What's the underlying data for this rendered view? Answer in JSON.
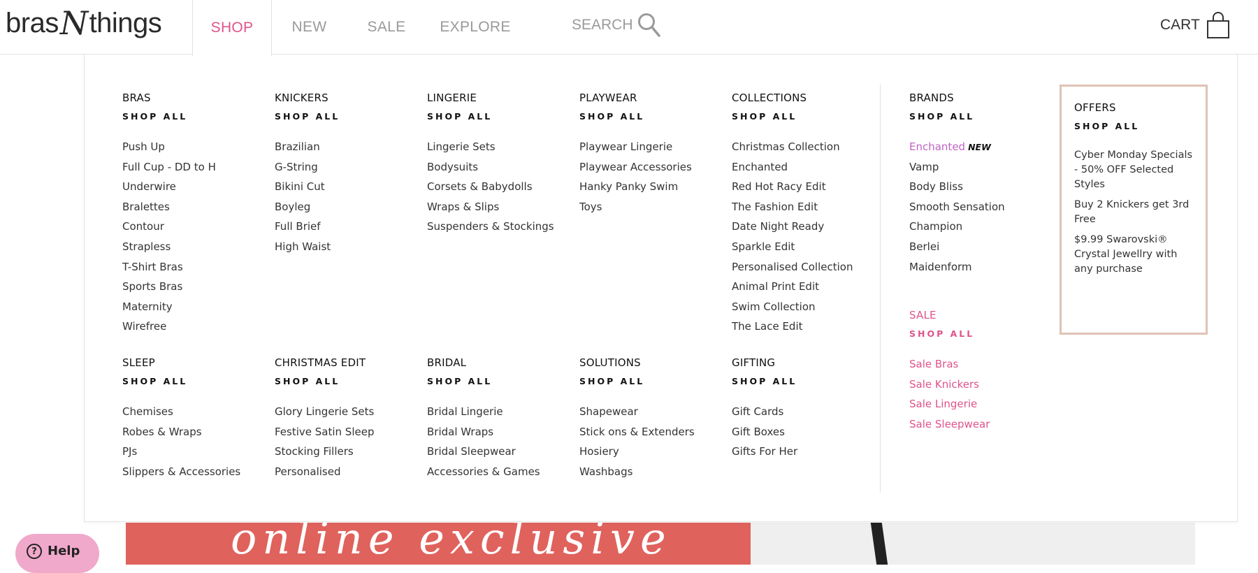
{
  "header": {
    "logo_left": "bras",
    "logo_mid": "N",
    "logo_right": "things",
    "nav": [
      {
        "label": "SHOP"
      },
      {
        "label": "NEW"
      },
      {
        "label": "SALE"
      },
      {
        "label": "EXPLORE"
      }
    ],
    "search_label": "SEARCH",
    "cart_label": "CART"
  },
  "menu": {
    "shop_all": "SHOP ALL",
    "row1": [
      {
        "title": "BRAS",
        "links": [
          "Push Up",
          "Full Cup - DD to H",
          "Underwire",
          "Bralettes",
          "Contour",
          "Strapless",
          "T-Shirt Bras",
          "Sports Bras",
          "Maternity",
          "Wirefree"
        ]
      },
      {
        "title": "KNICKERS",
        "links": [
          "Brazilian",
          "G-String",
          "Bikini Cut",
          "Boyleg",
          "Full Brief",
          "High Waist"
        ]
      },
      {
        "title": "LINGERIE",
        "links": [
          "Lingerie Sets",
          "Bodysuits",
          "Corsets & Babydolls",
          "Wraps & Slips",
          "Suspenders & Stockings"
        ]
      },
      {
        "title": "PLAYWEAR",
        "links": [
          "Playwear Lingerie",
          "Playwear Accessories",
          "Hanky Panky Swim",
          "Toys"
        ]
      },
      {
        "title": "COLLECTIONS",
        "links": [
          "Christmas Collection",
          "Enchanted",
          "Red Hot Racy Edit",
          "The Fashion Edit",
          "Date Night Ready",
          "Sparkle Edit",
          "Personalised Collection",
          "Animal Print Edit",
          "Swim Collection",
          "The Lace Edit"
        ]
      }
    ],
    "row2": [
      {
        "title": "SLEEP",
        "links": [
          "Chemises",
          "Robes & Wraps",
          "PJs",
          "Slippers & Accessories"
        ]
      },
      {
        "title": "CHRISTMAS EDIT",
        "links": [
          "Glory Lingerie Sets",
          "Festive Satin Sleep",
          "Stocking Fillers",
          "Personalised"
        ]
      },
      {
        "title": "BRIDAL",
        "links": [
          "Bridal Lingerie",
          "Bridal Wraps",
          "Bridal Sleepwear",
          "Accessories & Games"
        ]
      },
      {
        "title": "SOLUTIONS",
        "links": [
          "Shapewear",
          "Stick ons & Extenders",
          "Hosiery",
          "Washbags"
        ]
      },
      {
        "title": "GIFTING",
        "links": [
          "Gift Cards",
          "Gift Boxes",
          "Gifts For Her"
        ]
      }
    ],
    "brands": {
      "title": "BRANDS",
      "featured": "Enchanted",
      "featured_tag": "NEW",
      "links": [
        "Vamp",
        "Body Bliss",
        "Smooth Sensation",
        "Champion",
        "Berlei",
        "Maidenform"
      ]
    },
    "sale": {
      "title": "SALE",
      "links": [
        "Sale Bras",
        "Sale Knickers",
        "Sale Lingerie",
        "Sale Sleepwear"
      ]
    },
    "offers": {
      "title": "OFFERS",
      "items": [
        "Cyber Monday Specials - 50% OFF Selected Styles",
        "Buy 2 Knickers get 3rd Free",
        "$9.99 Swarovski® Crystal Jewellry with any purchase"
      ]
    }
  },
  "hero": {
    "text": "online exclusive"
  },
  "help": {
    "label": "Help"
  },
  "colors": {
    "accent": "#e0538a",
    "enchanted": "#c063c4",
    "offers_border": "#dfc3b6",
    "hero": "#e0625d"
  }
}
